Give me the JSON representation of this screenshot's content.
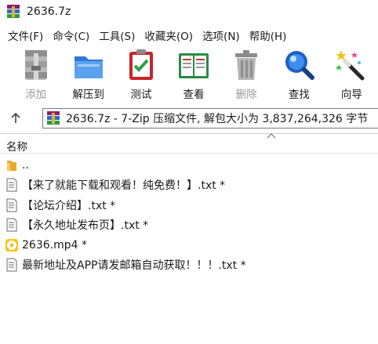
{
  "window": {
    "title": "2636.7z"
  },
  "menu": [
    "文件(F)",
    "命令(C)",
    "工具(S)",
    "收藏夹(O)",
    "选项(N)",
    "帮助(H)"
  ],
  "toolbar": [
    {
      "label": "添加",
      "icon": "archive-add-icon",
      "disabled": true
    },
    {
      "label": "解压到",
      "icon": "folder-extract-icon",
      "disabled": false
    },
    {
      "label": "测试",
      "icon": "clipboard-check-icon",
      "disabled": false
    },
    {
      "label": "查看",
      "icon": "book-view-icon",
      "disabled": false
    },
    {
      "label": "删除",
      "icon": "trash-icon",
      "disabled": true
    },
    {
      "label": "查找",
      "icon": "magnifier-icon",
      "disabled": false
    },
    {
      "label": "向导",
      "icon": "wizard-wand-icon",
      "disabled": false
    }
  ],
  "address": {
    "text": "2636.7z - 7-Zip 压缩文件, 解包大小为 3,837,264,326 字节"
  },
  "list": {
    "column_name": "名称",
    "items": [
      {
        "name": "..",
        "type": "folder"
      },
      {
        "name": "【来了就能下载和观看！纯免费！】.txt *",
        "type": "text"
      },
      {
        "name": "【论坛介绍】.txt *",
        "type": "text"
      },
      {
        "name": "【永久地址发布页】.txt *",
        "type": "text"
      },
      {
        "name": "2636.mp4 *",
        "type": "video"
      },
      {
        "name": "最新地址及APP请发邮箱自动获取！！！.txt *",
        "type": "text"
      }
    ]
  },
  "colors": {
    "disabled_text": "#9a9a9a",
    "folder": "#f4c24a",
    "video": "#f6c619"
  }
}
